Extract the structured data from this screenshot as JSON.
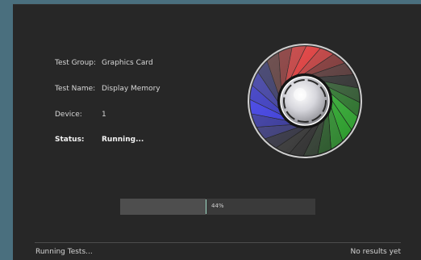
{
  "test_info": {
    "group_label": "Test Group:",
    "group_value": "Graphics Card",
    "name_label": "Test Name:",
    "name_value": "Display Memory",
    "device_label": "Device:",
    "device_value": "1",
    "status_label": "Status:",
    "status_value": "Running..."
  },
  "progress": {
    "value": 0.44,
    "label": "44%"
  },
  "footer": {
    "left": "Running Tests...",
    "right": "No results yet"
  },
  "colors": {
    "background": "#272727",
    "desktop": "#4a6f7e",
    "progress_edge": "#9fdbc6"
  },
  "icons": {
    "activity": "color-fan-icon"
  }
}
